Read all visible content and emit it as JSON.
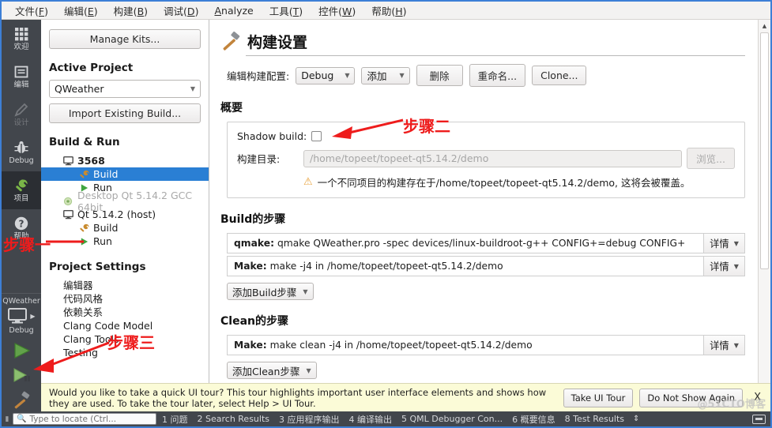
{
  "menubar": {
    "items": [
      {
        "text": "文件(",
        "mn": "F",
        "tail": ")"
      },
      {
        "text": "编辑(",
        "mn": "E",
        "tail": ")"
      },
      {
        "text": "构建(",
        "mn": "B",
        "tail": ")"
      },
      {
        "text": "调试(",
        "mn": "D",
        "tail": ")"
      },
      {
        "text": "",
        "mn": "A",
        "tail": "nalyze"
      },
      {
        "text": "工具(",
        "mn": "T",
        "tail": ")"
      },
      {
        "text": "控件(",
        "mn": "W",
        "tail": ")"
      },
      {
        "text": "帮助(",
        "mn": "H",
        "tail": ")"
      }
    ]
  },
  "modebar": {
    "modes": [
      {
        "label": "欢迎",
        "icon": "grid-icon",
        "state": "normal"
      },
      {
        "label": "编辑",
        "icon": "document-icon",
        "state": "normal"
      },
      {
        "label": "设计",
        "icon": "pencil-icon",
        "state": "disabled"
      },
      {
        "label": "Debug",
        "icon": "bug-icon",
        "state": "normal"
      },
      {
        "label": "项目",
        "icon": "wrench-icon",
        "state": "active"
      },
      {
        "label": "帮助",
        "icon": "question-icon",
        "state": "normal"
      }
    ],
    "run_target": {
      "kit_label": "QWeather",
      "build_config_label": "Debug",
      "target_icon": "monitor-icon",
      "run_icon": "run-triangle-icon",
      "debug_icon": "debug-run-icon",
      "build_icon": "hammer-icon"
    }
  },
  "sidepanel": {
    "manage_kits_label": "Manage Kits...",
    "active_project_title": "Active Project",
    "active_project_value": "QWeather",
    "import_build_label": "Import Existing Build...",
    "build_and_run_title": "Build & Run",
    "tree": [
      {
        "label": "3568",
        "level": 1,
        "icon": "monitor-icon",
        "state": "bold"
      },
      {
        "label": "Build",
        "level": 2,
        "icon": "wrench-icon",
        "state": "selected"
      },
      {
        "label": "Run",
        "level": 2,
        "icon": "run-triangle-icon",
        "state": "normal"
      },
      {
        "label": "Desktop Qt 5.14.2 GCC 64bit",
        "level": 1,
        "icon": "circle-icon",
        "state": "dim"
      },
      {
        "label": "Qt 5.14.2 (host)",
        "level": 1,
        "icon": "monitor-icon",
        "state": "normal"
      },
      {
        "label": "Build",
        "level": 2,
        "icon": "wrench-icon",
        "state": "normal"
      },
      {
        "label": "Run",
        "level": 2,
        "icon": "run-triangle-icon",
        "state": "normal"
      }
    ],
    "project_settings_title": "Project Settings",
    "settings": [
      {
        "label": "编辑器"
      },
      {
        "label": "代码风格"
      },
      {
        "label": "依赖关系"
      },
      {
        "label": "Clang Code Model"
      },
      {
        "label": "Clang Tools"
      },
      {
        "label": "Testing"
      }
    ]
  },
  "main": {
    "title": "构建设置",
    "title_icon": "hammer-icon",
    "config_row": {
      "label": "编辑构建配置:",
      "config_value": "Debug",
      "add_label": "添加",
      "remove_label": "删除",
      "rename_label": "重命名...",
      "clone_label": "Clone..."
    },
    "summary": {
      "heading": "概要",
      "shadow_build_label": "Shadow build:",
      "shadow_build_checked": false,
      "build_dir_label": "构建目录:",
      "build_dir_value": "/home/topeet/topeet-qt5.14.2/demo",
      "browse_label": "浏览...",
      "warning_icon": "warning-triangle-icon",
      "warning_text": "一个不同项目的构建存在于/home/topeet/topeet-qt5.14.2/demo, 这将会被覆盖。"
    },
    "build_steps": {
      "heading": "Build的步骤",
      "steps": [
        {
          "name": "qmake:",
          "detail": "qmake QWeather.pro -spec devices/linux-buildroot-g++ CONFIG+=debug CONFIG+",
          "details_label": "详情"
        },
        {
          "name": "Make:",
          "detail": "make -j4 in /home/topeet/topeet-qt5.14.2/demo",
          "details_label": "详情"
        }
      ],
      "add_label": "添加Build步骤"
    },
    "clean_steps": {
      "heading": "Clean的步骤",
      "steps": [
        {
          "name": "Make:",
          "detail": "make clean -j4 in /home/topeet/topeet-qt5.14.2/demo",
          "details_label": "详情"
        }
      ],
      "add_label": "添加Clean步骤"
    }
  },
  "tour_banner": {
    "text": "Would you like to take a quick UI tour? This tour highlights important user interface elements and shows how they are used. To take the tour later, select Help > UI Tour.",
    "take_tour_label": "Take UI Tour",
    "dismiss_label": "Do Not Show Again",
    "close_label": "X"
  },
  "statusbar": {
    "locator_placeholder": "Type to locate (Ctrl...",
    "locator_icon": "search-icon",
    "panes": [
      {
        "num": "1",
        "label": "问题"
      },
      {
        "num": "2",
        "label": "Search Results"
      },
      {
        "num": "3",
        "label": "应用程序输出"
      },
      {
        "num": "4",
        "label": "编译输出"
      },
      {
        "num": "5",
        "label": "QML Debugger Con..."
      },
      {
        "num": "6",
        "label": "概要信息"
      },
      {
        "num": "8",
        "label": "Test Results"
      }
    ],
    "updown_icon": "updown-arrows-icon"
  },
  "annotations": {
    "step1": "步骤一",
    "step2": "步骤二",
    "step3": "步骤三",
    "color": "#ee1c1c"
  },
  "watermark": "@51CTO博客"
}
